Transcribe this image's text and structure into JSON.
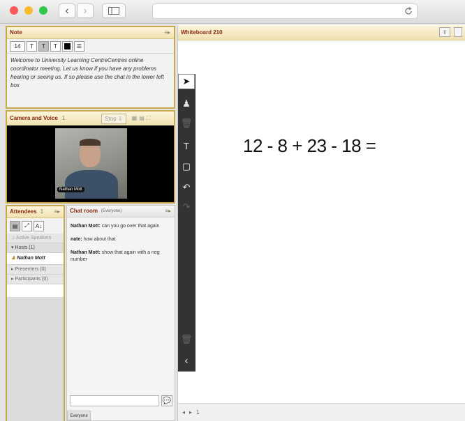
{
  "browser": {
    "back": "‹",
    "forward": "›"
  },
  "note": {
    "title": "Note",
    "font_size": "14",
    "text": "Welcome to University Learning CentreCentres online coordinator meeting. Let us know if you have any problems hearing or seeing us. If so please use the chat in the lower left box"
  },
  "camera": {
    "title": "Camera and Voice",
    "count": "1",
    "stop_label": "Stop",
    "speaker_name": "Nathan Mott"
  },
  "attendees": {
    "title": "Attendees",
    "count": "1",
    "active_speakers": "Active Speakers",
    "hosts": "Hosts (1)",
    "host_name": "Nathan Mott",
    "presenters": "Presenters (0)",
    "participants": "Participants (0)"
  },
  "chat": {
    "title": "Chat room",
    "scope": "(Everyone)",
    "messages": [
      {
        "sender": "Nathan Mott:",
        "text": "can you go over that again"
      },
      {
        "sender": "nate:",
        "text": "how about that"
      },
      {
        "sender": "Nathan Mott:",
        "text": "show that again with a neg number"
      }
    ],
    "recipient_tab": "Everyone"
  },
  "whiteboard": {
    "title": "Whiteboard 210",
    "expression": "12 - 8 + 23 - 18 =",
    "page_number": "1"
  },
  "colors": {
    "panel_border": "#c8a84a",
    "title_text": "#8a2a14",
    "toolbar_bg": "#333333"
  }
}
